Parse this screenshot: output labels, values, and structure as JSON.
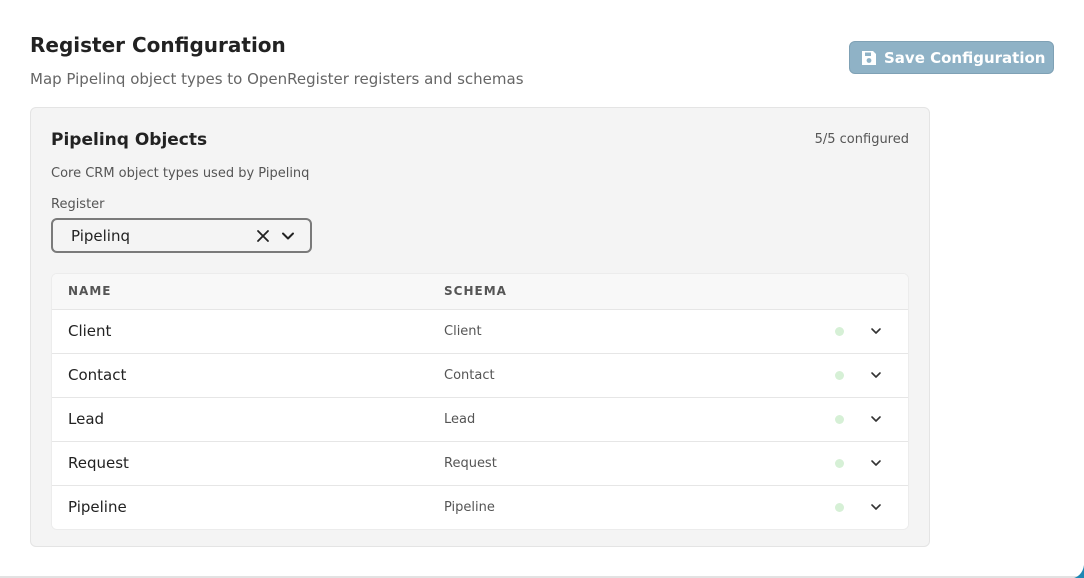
{
  "header": {
    "title": "Register Configuration",
    "subtitle": "Map Pipelinq object types to OpenRegister registers and schemas",
    "save_label": "Save Configuration"
  },
  "card": {
    "title": "Pipelinq Objects",
    "status": "5/5 configured",
    "description": "Core CRM object types used by Pipelinq",
    "register_label": "Register",
    "register_value": "Pipelinq"
  },
  "table": {
    "columns": {
      "name": "NAME",
      "schema": "SCHEMA"
    },
    "rows": [
      {
        "name": "Client",
        "schema": "Client"
      },
      {
        "name": "Contact",
        "schema": "Contact"
      },
      {
        "name": "Lead",
        "schema": "Lead"
      },
      {
        "name": "Request",
        "schema": "Request"
      },
      {
        "name": "Pipeline",
        "schema": "Pipeline"
      }
    ]
  },
  "icons": {
    "save": "floppy-disk-icon",
    "clear": "close-icon",
    "dropdown": "chevron-down-icon",
    "status": "status-dot"
  },
  "colors": {
    "save_button_bg": "#8fb2c6",
    "status_dot": "#d6f0d6",
    "corner_accent": "#1e88b4"
  }
}
